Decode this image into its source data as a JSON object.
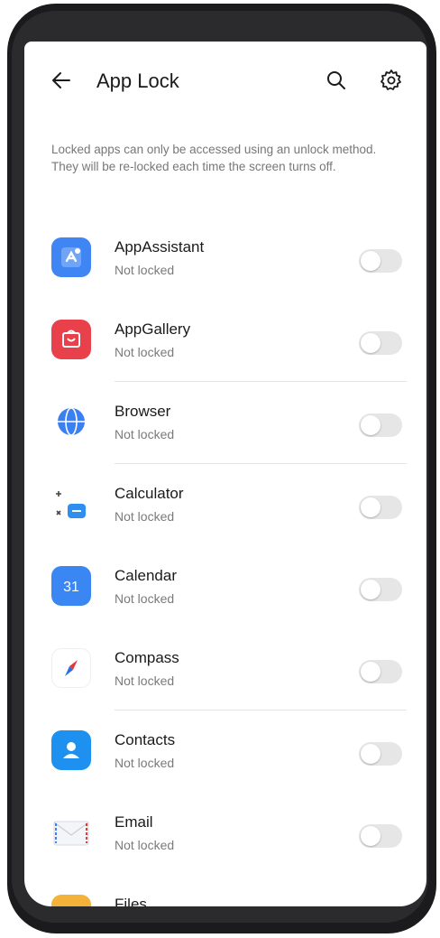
{
  "header": {
    "title": "App Lock",
    "back_icon": "back-arrow-icon",
    "search_icon": "search-icon",
    "settings_icon": "gear-icon"
  },
  "description": "Locked apps can only be accessed using an unlock method. They will be re-locked each time the screen turns off.",
  "apps": [
    {
      "name": "AppAssistant",
      "status": "Not locked",
      "icon": "app-assistant-icon",
      "color": "#3f86f4",
      "locked": false
    },
    {
      "name": "AppGallery",
      "status": "Not locked",
      "icon": "app-gallery-icon",
      "color": "#e8414c",
      "locked": false
    },
    {
      "name": "Browser",
      "status": "Not locked",
      "icon": "browser-icon",
      "color": "#3b80f0",
      "locked": false
    },
    {
      "name": "Calculator",
      "status": "Not locked",
      "icon": "calculator-icon",
      "color": "#2e8ff0",
      "locked": false
    },
    {
      "name": "Calendar",
      "status": "Not locked",
      "icon": "calendar-icon",
      "color": "#3a86f2",
      "locked": false
    },
    {
      "name": "Compass",
      "status": "Not locked",
      "icon": "compass-icon",
      "color": "#e53935",
      "locked": false
    },
    {
      "name": "Contacts",
      "status": "Not locked",
      "icon": "contacts-icon",
      "color": "#1e90f0",
      "locked": false
    },
    {
      "name": "Email",
      "status": "Not locked",
      "icon": "email-icon",
      "color": "#3b82f6",
      "locked": false
    },
    {
      "name": "Files",
      "status": "",
      "icon": "files-icon",
      "color": "#f4b23a",
      "locked": false
    }
  ]
}
